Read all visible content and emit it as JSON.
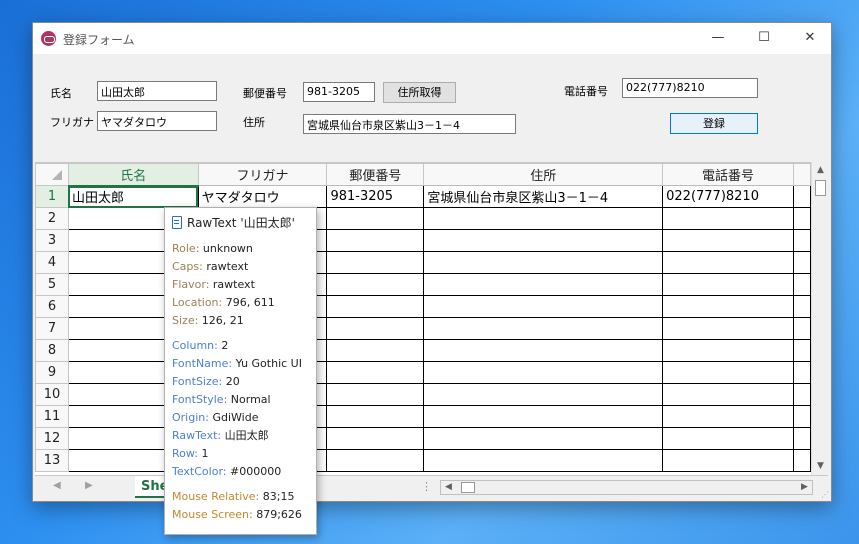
{
  "window": {
    "title": "登録フォーム",
    "minimize": "—",
    "maximize": "☐",
    "close": "✕"
  },
  "form": {
    "name_label": "氏名",
    "name_value": "山田太郎",
    "furigana_label": "フリガナ",
    "furigana_value": "ヤマダタロウ",
    "postal_label": "郵便番号",
    "postal_value": "981-3205",
    "get_address_button": "住所取得",
    "address_label": "住所",
    "address_value": "宮城県仙台市泉区紫山3－1－4",
    "phone_label": "電話番号",
    "phone_value": "022(777)8210",
    "register_button": "登録"
  },
  "grid": {
    "columns": [
      "氏名",
      "フリガナ",
      "郵便番号",
      "住所",
      "電話番号"
    ],
    "row_numbers": [
      "1",
      "2",
      "3",
      "4",
      "5",
      "6",
      "7",
      "8",
      "9",
      "10",
      "11",
      "12",
      "13"
    ],
    "rows": [
      [
        "山田太郎",
        "ヤマダタロウ",
        "981-3205",
        "宮城県仙台市泉区紫山3－1－4",
        "022(777)8210"
      ]
    ],
    "sheet_tab": "She"
  },
  "tooltip": {
    "header": "RawText '山田太郎'",
    "group1": [
      {
        "key": "Role:",
        "value": "unknown"
      },
      {
        "key": "Caps:",
        "value": "rawtext"
      },
      {
        "key": "Flavor:",
        "value": "rawtext"
      },
      {
        "key": "Location:",
        "value": "796, 611"
      },
      {
        "key": "Size:",
        "value": "126, 21"
      }
    ],
    "group2": [
      {
        "key": "Column:",
        "value": "2"
      },
      {
        "key": "FontName:",
        "value": "Yu Gothic UI"
      },
      {
        "key": "FontSize:",
        "value": "20"
      },
      {
        "key": "FontStyle:",
        "value": "Normal"
      },
      {
        "key": "Origin:",
        "value": "GdiWide"
      },
      {
        "key": "RawText:",
        "value": "山田太郎"
      },
      {
        "key": "Row:",
        "value": "1"
      },
      {
        "key": "TextColor:",
        "value": "#000000"
      }
    ],
    "group3": [
      {
        "key": "Mouse Relative:",
        "value": "83;15"
      },
      {
        "key": "Mouse Screen:",
        "value": "879;626"
      }
    ]
  },
  "colors": {
    "desktop": "#2d8ff0",
    "accent_green": "#217346",
    "accent_blue": "#0078d7"
  }
}
